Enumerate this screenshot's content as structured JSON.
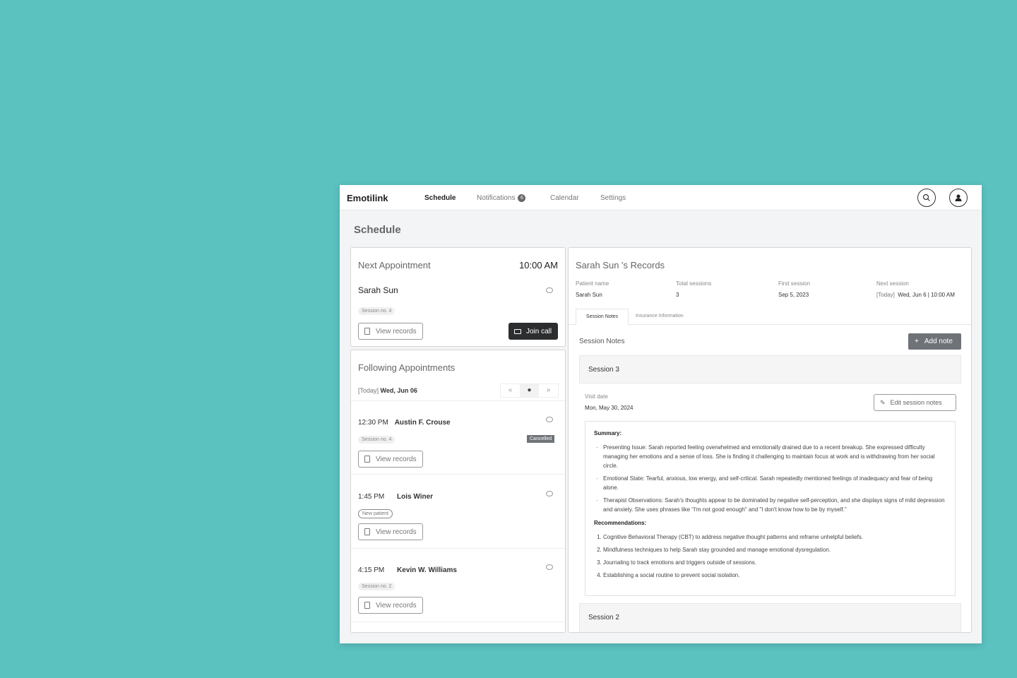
{
  "nav": {
    "brand": "Emotilink",
    "items": [
      {
        "label": "Schedule",
        "active": true
      },
      {
        "label": "Notifications",
        "badge": "6"
      },
      {
        "label": "Calendar"
      },
      {
        "label": "Settings"
      }
    ],
    "search_icon": "search-icon",
    "profile_icon": "user-icon"
  },
  "page_title": "Schedule",
  "next_appointment": {
    "title": "Next Appointment",
    "time": "10:00 AM",
    "patient": "Sarah Sun",
    "session": "Session no. 4",
    "view_records": "View records",
    "join_call": "Join call"
  },
  "following": {
    "title": "Following Appointments",
    "today": "[Today]",
    "date": "Wed, Jun 06",
    "items": [
      {
        "time": "12:30 PM",
        "name": "Austin F. Crouse",
        "tag": "Session no. 4",
        "status": "Cancelled",
        "view_records": "View records"
      },
      {
        "time": "1:45 PM",
        "name": "Lois Winer",
        "tag": "New patient",
        "view_records": "View records"
      },
      {
        "time": "4:15 PM",
        "name": "Kevin W. Williams",
        "tag": "Session no. 2",
        "view_records": "View records"
      }
    ]
  },
  "records": {
    "title": "Sarah Sun 's Records",
    "fields": [
      {
        "label": "Patient name",
        "value": "Sarah Sun"
      },
      {
        "label": "Total sessions",
        "value": "3"
      },
      {
        "label": "First session",
        "value": "Sep 5, 2023"
      },
      {
        "label": "Next session",
        "prefix": "[Today]",
        "value": "Wed, Jun 6 | 10:00 AM"
      }
    ],
    "tabs": [
      {
        "label": "Session Notes",
        "active": true
      },
      {
        "label": "Insurance Information"
      }
    ],
    "section_title": "Session Notes",
    "add_note": "Add note",
    "session3": {
      "title": "Session 3",
      "visit_label": "Visit date",
      "visit_date": "Mon, May 30, 2024",
      "edit": "Edit session notes",
      "summary_title": "Summary:",
      "summary": [
        "Presenting Issue: Sarah reported feeling overwhelmed and emotionally drained due to a recent breakup. She expressed difficulty managing her emotions and a sense of loss. She is finding it challenging to maintain focus at work and is withdrawing from her social circle.",
        "Emotional State: Tearful, anxious, low energy, and self-critical. Sarah repeatedly mentioned feelings of inadequacy and fear of being alone.",
        "Therapist Observations: Sarah's thoughts appear to be dominated by negative self-perception, and she displays signs of mild depression and anxiety. She uses phrases like \"I'm not good enough\" and \"I don't know how to be by myself.\""
      ],
      "rec_title": "Recommendations:",
      "recommendations": [
        "Cognitive Behavioral Therapy (CBT) to address negative thought patterns and reframe unhelpful beliefs.",
        "Mindfulness techniques to help Sarah stay grounded and manage emotional dysregulation.",
        "Journaling to track emotions and triggers outside of sessions.",
        "Establishing a social routine to prevent social isolation."
      ]
    },
    "session2": {
      "title": "Session 2"
    }
  },
  "colors": {
    "background": "#5bc2c0",
    "dark_button": "#2b2d2f",
    "grey_button": "#6f7378"
  }
}
